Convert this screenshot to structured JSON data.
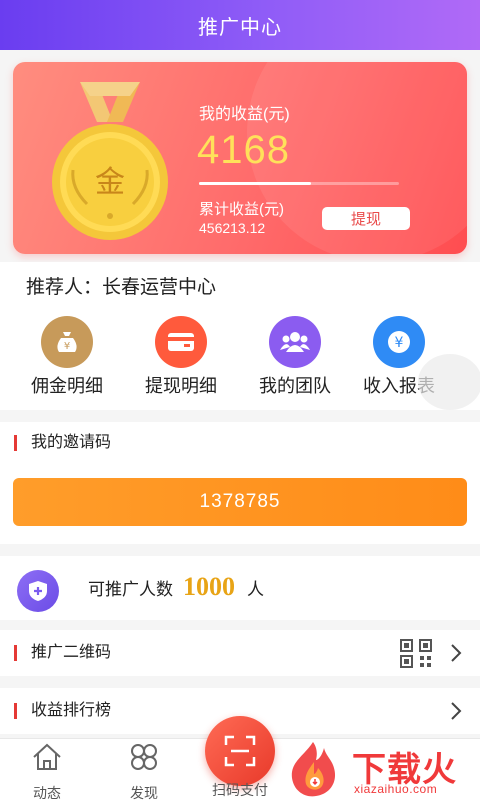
{
  "header": {
    "title": "推广中心"
  },
  "earnings": {
    "label": "我的收益(元)",
    "value": "4168",
    "progress_fraction": 0.56,
    "total_label": "累计收益(元)",
    "total_value": "456213.12",
    "withdraw_label": "提现",
    "medal_text": "金"
  },
  "referrer": {
    "text": "推荐人：长春运营中心"
  },
  "shortcuts": [
    {
      "label": "佣金明细",
      "icon": "money-bag-icon",
      "color": "#c79a5a"
    },
    {
      "label": "提现明细",
      "icon": "card-icon",
      "color": "#ff5a3c"
    },
    {
      "label": "我的团队",
      "icon": "team-icon",
      "color": "#8b5cf0"
    },
    {
      "label": "收入报表",
      "icon": "yen-icon",
      "color": "#2f8bf5"
    }
  ],
  "invite": {
    "title": "我的邀请码",
    "code": "1378785"
  },
  "quota": {
    "prefix": "可推广人数",
    "number": "1000",
    "suffix": "人"
  },
  "rows": {
    "qr": {
      "label": "推广二维码"
    },
    "ranking": {
      "label": "收益排行榜"
    }
  },
  "bottom_nav": {
    "items": [
      {
        "label": "动态",
        "icon": "home-icon"
      },
      {
        "label": "发现",
        "icon": "clover-icon"
      }
    ],
    "scan_label": "扫码支付"
  },
  "watermark": {
    "brand": "下载火",
    "url": "xiazaihuo.com"
  },
  "colors": {
    "header": "#7b4cf2",
    "card": "#ff6b6b",
    "accent_orange": "#ff9620",
    "gold": "#e8a416",
    "red": "#e53935"
  }
}
